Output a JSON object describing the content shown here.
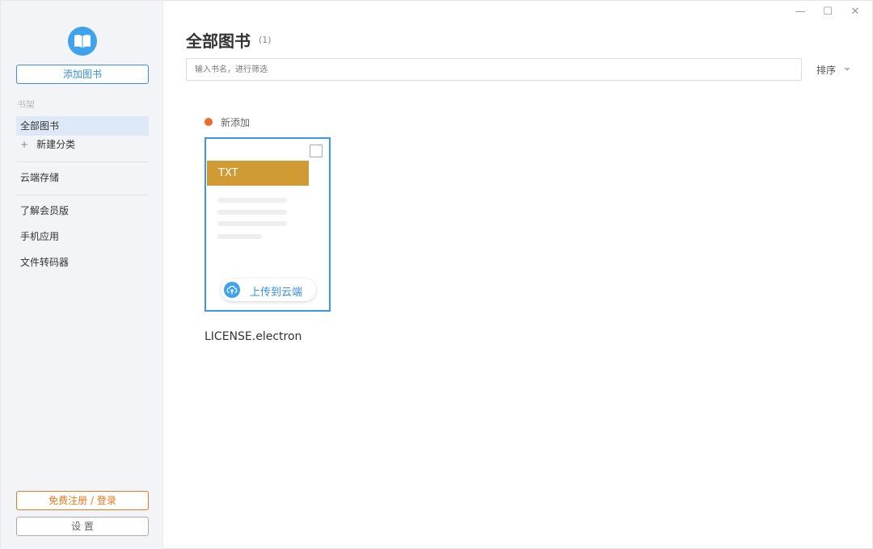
{
  "sidebar": {
    "add_book_label": "添加图书",
    "shelf_section_label": "书架",
    "items": [
      {
        "label": "全部图书"
      },
      {
        "label": "新建分类",
        "icon": "+"
      },
      {
        "label": "云端存储"
      },
      {
        "label": "了解会员版"
      },
      {
        "label": "手机应用"
      },
      {
        "label": "文件转码器"
      }
    ],
    "login_label": "免费注册 / 登录",
    "settings_label": "设 置"
  },
  "window_controls": {
    "minimize": "—",
    "maximize": "☐",
    "close": "✕"
  },
  "main": {
    "title": "全部图书",
    "count": "(1)",
    "search_placeholder": "输入书名，进行筛选",
    "sort_label": "排序",
    "group_label": "新添加"
  },
  "books": [
    {
      "format": "TXT",
      "upload_label": "上传到云端",
      "name": "LICENSE.electron"
    }
  ],
  "colors": {
    "accent": "#3a8ee6",
    "login": "#e8761f",
    "new_dot": "#ee6a2a",
    "txt_tag": "#d19b34"
  }
}
